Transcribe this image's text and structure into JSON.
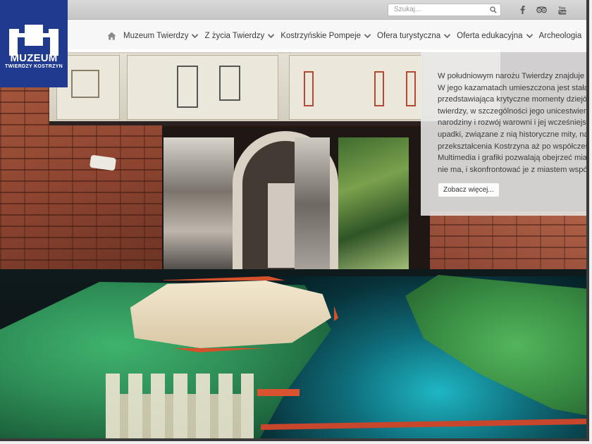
{
  "logo": {
    "title": "MUZEUM",
    "subtitle": "TWIERDZY KOSTRZYN",
    "background": "#1f3a8e"
  },
  "topbar": {
    "search_placeholder": "Szukaj...",
    "search_icon": "magnifier",
    "social_icons": [
      "facebook-icon",
      "tripadvisor-icon",
      "youtube-icon"
    ]
  },
  "nav": {
    "home_icon": "home-icon",
    "items": [
      {
        "label": "Muzeum Twierdzy",
        "has_dropdown": true
      },
      {
        "label": "Z życia Twierdzy",
        "has_dropdown": true
      },
      {
        "label": "Kostrzyńskie Pompeje",
        "has_dropdown": true
      },
      {
        "label": "Ofera turystyczna",
        "has_dropdown": true
      },
      {
        "label": "Oferta edukacyjna",
        "has_dropdown": true
      },
      {
        "label": "Archeologia",
        "has_dropdown": false
      }
    ]
  },
  "info_panel": {
    "lines": [
      "W południowym narożu Twierdzy znajduje się B",
      "W jego kazamatach umieszczona jest stała eks",
      "przedstawiająca krytyczne momenty dziejów m",
      "twierdzy, w szczególności jego unicestwienie w",
      "narodziny i rozwój warowni i jej wcześniejsze w",
      "upadki, związane z nią historyczne mity, naresz",
      "przekształcenia Kostrzyna aż po współczesnoś",
      "Multimedia i grafiki pozwalają obejrzeć miasto,",
      "nie ma, i skonfrontować je z miastem współcze"
    ],
    "button_label": "Zobacz więcej..."
  },
  "colors": {
    "accent_blue": "#1f3a8e",
    "nav_text": "#3a3a3a",
    "topbar_bg": "#cfcfcf"
  }
}
